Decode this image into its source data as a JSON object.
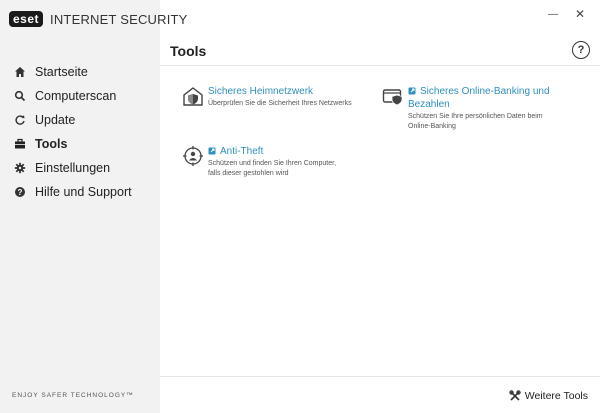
{
  "app": {
    "logo": "eset",
    "product": "INTERNET SECURITY"
  },
  "window": {
    "minimize": "—",
    "close": "✕"
  },
  "sidebar": {
    "items": [
      {
        "label": "Startseite",
        "icon": "home-icon"
      },
      {
        "label": "Computerscan",
        "icon": "search-icon"
      },
      {
        "label": "Update",
        "icon": "refresh-icon"
      },
      {
        "label": "Tools",
        "icon": "briefcase-icon",
        "active": true
      },
      {
        "label": "Einstellungen",
        "icon": "gear-icon"
      },
      {
        "label": "Hilfe und Support",
        "icon": "question-icon"
      }
    ],
    "footer": "ENJOY SAFER TECHNOLOGY™"
  },
  "main": {
    "title": "Tools",
    "help": "?",
    "tools": [
      {
        "title": "Sicheres Heimnetzwerk",
        "desc": "Überprüfen Sie die Sicherheit Ihres Netzwerks",
        "icon": "home-shield-icon"
      },
      {
        "title_line1": "Sicheres Online-Banking und",
        "title_line2": "Bezahlen",
        "desc_line1": "Schützen Sie Ihre persönlichen Daten beim",
        "desc_line2": "Online-Banking",
        "icon": "browser-shield-icon"
      },
      {
        "title": "Anti-Theft",
        "desc_line1": "Schützen und finden Sie Ihren Computer,",
        "desc_line2": "falls dieser gestohlen wird",
        "icon": "anti-theft-icon"
      }
    ],
    "more_tools": "Weitere Tools"
  },
  "colors": {
    "link": "#2f8fbf",
    "sidebar_bg": "#f2f2f2"
  }
}
